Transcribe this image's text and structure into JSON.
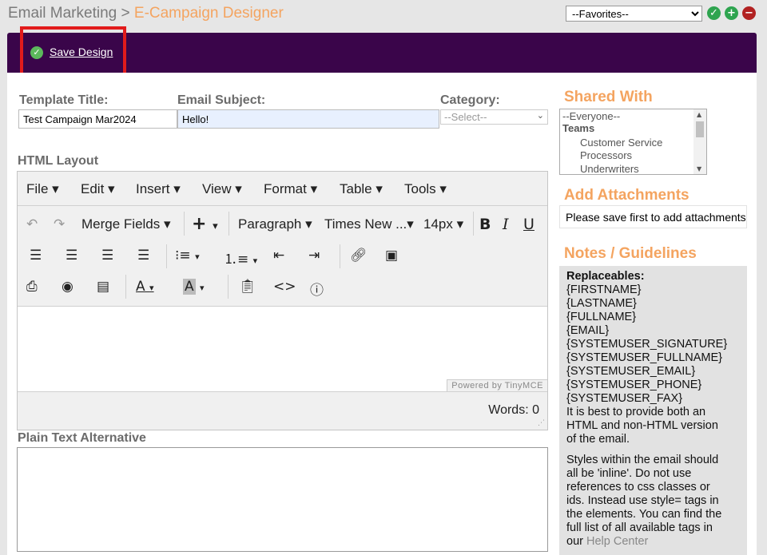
{
  "breadcrumb": {
    "root": "Email Marketing",
    "separator": ">",
    "current": "E-Campaign Designer"
  },
  "favorites": {
    "selected": "--Favorites--"
  },
  "header_actions": {
    "ok": "✓",
    "add": "+",
    "remove": "−"
  },
  "save_design": {
    "label": "Save Design"
  },
  "form": {
    "template_title_label": "Template Title:",
    "template_title_value": "Test Campaign Mar2024",
    "email_subject_label": "Email Subject:",
    "email_subject_value": "Hello!",
    "category_label": "Category:",
    "category_selected": "--Select--"
  },
  "html_layout": {
    "label": "HTML Layout",
    "menus": [
      "File",
      "Edit",
      "Insert",
      "View",
      "Format",
      "Table",
      "Tools"
    ],
    "merge_fields": "Merge Fields",
    "block_format": "Paragraph",
    "font_family": "Times New ...",
    "font_size": "14px",
    "powered_by": "Powered by TinyMCE",
    "words": "Words: 0"
  },
  "plain_text": {
    "label": "Plain Text Alternative"
  },
  "shared_with": {
    "title": "Shared With",
    "options": [
      {
        "label": "--Everyone--",
        "kind": "option"
      },
      {
        "label": "Teams",
        "kind": "group"
      },
      {
        "label": "Customer Service",
        "kind": "option"
      },
      {
        "label": "Processors",
        "kind": "option"
      },
      {
        "label": "Underwriters",
        "kind": "option"
      }
    ]
  },
  "attachments": {
    "title": "Add Attachments",
    "message": "Please save first to add attachments"
  },
  "notes": {
    "title": "Notes / Guidelines",
    "replaceables_label": "Replaceables:",
    "replaceables": [
      "{FIRSTNAME}",
      "{LASTNAME}",
      "{FULLNAME}",
      "{EMAIL}",
      "{SYSTEMUSER_SIGNATURE}",
      "{SYSTEMUSER_FULLNAME}",
      "{SYSTEMUSER_EMAIL}",
      "{SYSTEMUSER_PHONE}",
      "{SYSTEMUSER_FAX}"
    ],
    "para1": [
      "It is best to provide both an",
      "HTML and non-HTML version",
      "of the email."
    ],
    "para2": [
      "Styles within the email should",
      "all be 'inline'. Do not use",
      "references to css classes or",
      "ids. Instead use style= tags in",
      "the elements. You can find the",
      "full list of all available tags in"
    ],
    "para2_last_prefix": "our",
    "help_link": "Help Center"
  },
  "colors": {
    "brand_bar": "#3a054a",
    "accent": "#f4a460",
    "highlight": "#e21b1b"
  }
}
